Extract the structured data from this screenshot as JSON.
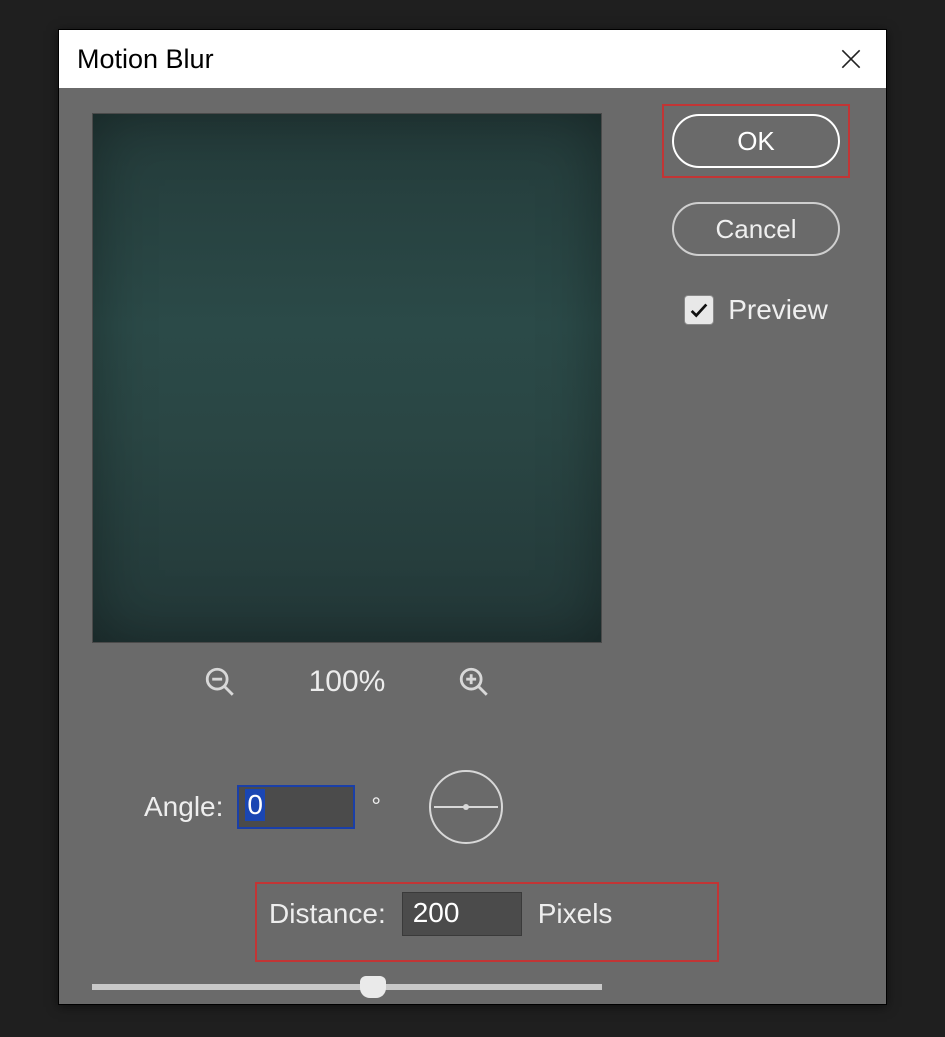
{
  "dialog": {
    "title": "Motion Blur"
  },
  "buttons": {
    "ok": "OK",
    "cancel": "Cancel"
  },
  "preview": {
    "checkbox_label": "Preview",
    "checked": true
  },
  "zoom": {
    "level": "100%"
  },
  "angle": {
    "label": "Angle:",
    "value": "0",
    "unit_symbol": "°"
  },
  "distance": {
    "label": "Distance:",
    "value": "200",
    "unit": "Pixels",
    "slider_percent": 55
  },
  "highlights": {
    "ok": true,
    "distance": true
  }
}
